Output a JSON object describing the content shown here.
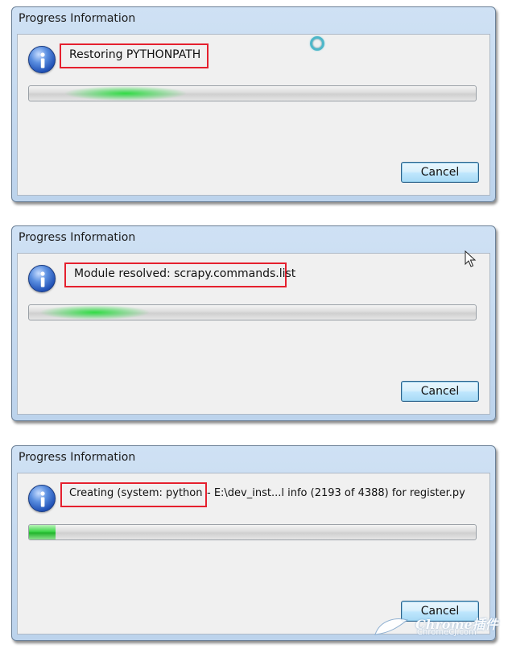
{
  "dialogs": [
    {
      "title": "Progress Information",
      "message": "Restoring PYTHONPATH",
      "message_tail": "",
      "cancel_label": "Cancel"
    },
    {
      "title": "Progress Information",
      "message": "Module resolved: scrapy.commands.list",
      "message_tail": "",
      "cancel_label": "Cancel"
    },
    {
      "title": "Progress Information",
      "message": "Creating (system: python",
      "message_tail": "- E:\\dev_inst...l info (2193 of 4388) for register.py",
      "cancel_label": "Cancel",
      "progress_fraction": 0.06
    }
  ],
  "colors": {
    "highlight_box": "#e5202e",
    "progress_green": "#22b52d"
  },
  "icons": [
    "info-icon",
    "busy-cursor-icon",
    "arrow-pointer-icon"
  ],
  "watermark": {
    "brand": "Chrome插件",
    "url": "ChromeCJ.com"
  }
}
